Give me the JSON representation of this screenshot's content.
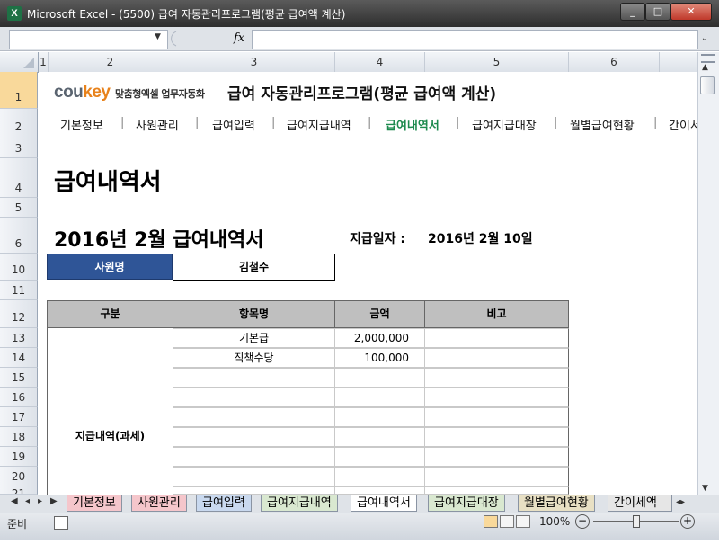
{
  "window": {
    "title": "Microsoft Excel - (5500) 급여 자동관리프로그램(평균 급여액 계산)",
    "app_icon": "X"
  },
  "window_controls": {
    "minimize": "_",
    "maximize": "□",
    "close": "✕"
  },
  "formula_bar": {
    "fx": "fx",
    "name_box": "",
    "formula": ""
  },
  "columns": [
    "1",
    "2",
    "3",
    "4",
    "5",
    "6"
  ],
  "rows": [
    "1",
    "2",
    "3",
    "4",
    "5",
    "6",
    "10",
    "11",
    "12",
    "13",
    "14",
    "15",
    "16",
    "17",
    "18",
    "19",
    "20",
    "21"
  ],
  "header": {
    "logo_main": "cou",
    "logo_accent": "key",
    "logo_sub": "맞춤형엑셀 업무자동화",
    "program_title": "급여 자동관리프로그램(평균 급여액 계산)"
  },
  "menu": [
    "기본정보",
    "사원관리",
    "급여입력",
    "급여지급내역",
    "급여내역서",
    "급여지급대장",
    "월별급여현황",
    "간이서"
  ],
  "menu_separator": "|",
  "doc_title": "급여내역서",
  "slip_title": "2016년 2월  급여내역서",
  "pay_date": {
    "label": "지급일자 :",
    "value": "2016년 2월 10일"
  },
  "employee": {
    "label": "사원명",
    "name": "김철수"
  },
  "table": {
    "headers": [
      "구분",
      "항목명",
      "금액",
      "비고"
    ],
    "group_label": "지급내역(과세)",
    "items": [
      {
        "name": "기본급",
        "amount": "2,000,000",
        "note": ""
      },
      {
        "name": "직책수당",
        "amount": "100,000",
        "note": ""
      },
      {
        "name": "",
        "amount": "",
        "note": ""
      },
      {
        "name": "",
        "amount": "",
        "note": ""
      },
      {
        "name": "",
        "amount": "",
        "note": ""
      },
      {
        "name": "",
        "amount": "",
        "note": ""
      },
      {
        "name": "",
        "amount": "",
        "note": ""
      },
      {
        "name": "",
        "amount": "",
        "note": ""
      },
      {
        "name": "",
        "amount": "",
        "note": ""
      }
    ]
  },
  "sheet_tabs": [
    "기본정보",
    "사원관리",
    "급여입력",
    "급여지급내역",
    "급여내역서",
    "급여지급대장",
    "월별급여현황",
    "간이세액"
  ],
  "active_tab": "급여내역서",
  "status": {
    "ready": "준비",
    "zoom": "100%",
    "zoom_out": "−",
    "zoom_in": "+"
  },
  "colors": {
    "accent_green": "#1d8a4e",
    "label_blue": "#2f5597",
    "logo_orange": "#e8821b"
  }
}
